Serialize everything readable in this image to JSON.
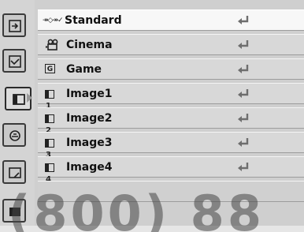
{
  "colors": {
    "selected_row": "#f7f7f7",
    "row": "#d8d8d8",
    "panel": "#cfcfcf"
  },
  "sidebar": {
    "tabs": [
      {
        "icon": "input-icon"
      },
      {
        "icon": "pc-adjust-icon"
      },
      {
        "icon": "image-select-icon",
        "active": true
      },
      {
        "icon": "image-adjust-icon"
      },
      {
        "icon": "screen-icon"
      },
      {
        "icon": "setting-icon"
      }
    ]
  },
  "menu": {
    "items": [
      {
        "label": "Standard",
        "icon": "standard-icon",
        "selected": true,
        "icon_text": "↠◇↠✓"
      },
      {
        "label": "Cinema",
        "icon": "film-camera-icon"
      },
      {
        "label": "Game",
        "icon": "game-icon",
        "icon_text": "G"
      },
      {
        "label": "Image1",
        "icon": "image-slot-icon",
        "slot": "1"
      },
      {
        "label": "Image2",
        "icon": "image-slot-icon",
        "slot": "2"
      },
      {
        "label": "Image3",
        "icon": "image-slot-icon",
        "slot": "3"
      },
      {
        "label": "Image4",
        "icon": "image-slot-icon",
        "slot": "4"
      }
    ],
    "enter_icon": "enter-return-icon"
  },
  "watermark": {
    "text": "(800) 88"
  }
}
